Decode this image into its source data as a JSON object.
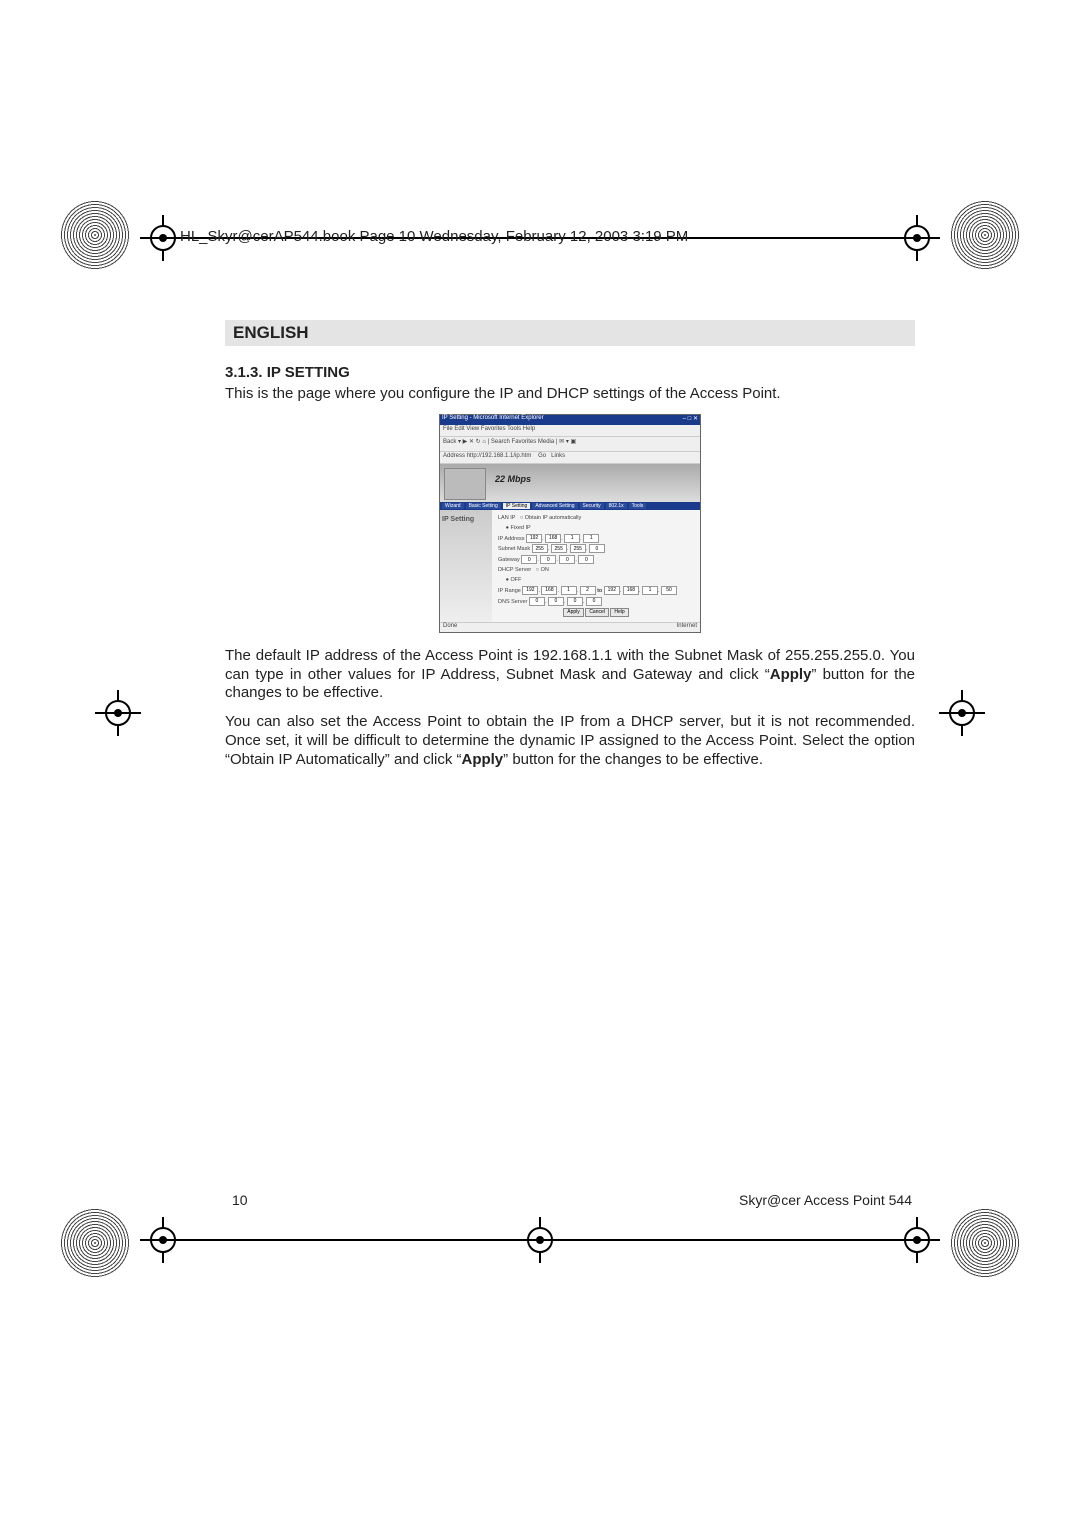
{
  "header_line": "HL_Skyr@cerAP544.book  Page 10  Wednesday, February 12, 2003  3:19 PM",
  "language_label": "ENGLISH",
  "section_heading": "3.1.3. IP SETTING",
  "intro_para": "This is the page where you configure the IP and DHCP settings of the Access Point.",
  "para2_pre": "The default IP address of the Access Point is 192.168.1.1 with the Subnet Mask of 255.255.255.0. You can type in other values for IP Address, Subnet Mask and Gateway and click “",
  "para2_bold": "Apply",
  "para2_post": "” button for the changes to be effective.",
  "para3_pre": "You can also set the Access Point to obtain the IP from a DHCP server, but it is not recommended. Once set, it will be difficult to determine the dynamic IP assigned to the Access Point. Select the option “Obtain IP Automatically” and click “",
  "para3_bold": "Apply",
  "para3_post": "” button for the changes to be effective.",
  "page_number": "10",
  "product_footer": "Skyr@cer Access Point 544",
  "shot": {
    "title": "IP Setting - Microsoft Internet Explorer",
    "win_controls": "– □ ✕",
    "menu": "File  Edit  View  Favorites  Tools  Help",
    "toolbar": "Back ▾  ▶  ✕ ↻ ⌂  | Search  Favorites  Media  | ✉ ▾ ▣",
    "address_label": "Address",
    "address_value": "http://192.168.1.1/ip.htm",
    "go": "Go",
    "links": "Links",
    "banner_logo": "22 Mbps",
    "tabs": [
      "Wizard",
      "Basic Setting",
      "IP Setting",
      "Advanced Setting",
      "Security",
      "802.1x",
      "Tools"
    ],
    "active_tab": "IP Setting",
    "side_label": "IP Setting",
    "lan": {
      "heading": "LAN IP",
      "auto_label": "Obtain IP automatically",
      "fixed_label": "Fixed IP",
      "ip_label": "IP Address",
      "ip": [
        "192",
        "168",
        "1",
        "1"
      ],
      "mask_label": "Subnet Mask",
      "mask": [
        "255",
        "255",
        "255",
        "0"
      ],
      "gw_label": "Gateway",
      "gw": [
        "0",
        "0",
        "0",
        "0"
      ]
    },
    "dhcp": {
      "heading": "DHCP Server",
      "on": "ON",
      "off": "OFF",
      "range_label": "IP Range",
      "from": [
        "192",
        "168",
        "1",
        "2"
      ],
      "to_label": "to",
      "to": [
        "192",
        "168",
        "1",
        "50"
      ],
      "dns_label": "DNS Server",
      "dns": [
        "0",
        "0",
        "0",
        "0"
      ]
    },
    "btn_apply": "Apply",
    "btn_cancel": "Cancel",
    "btn_help": "Help",
    "status_done": "Done",
    "status_zone": "Internet"
  }
}
